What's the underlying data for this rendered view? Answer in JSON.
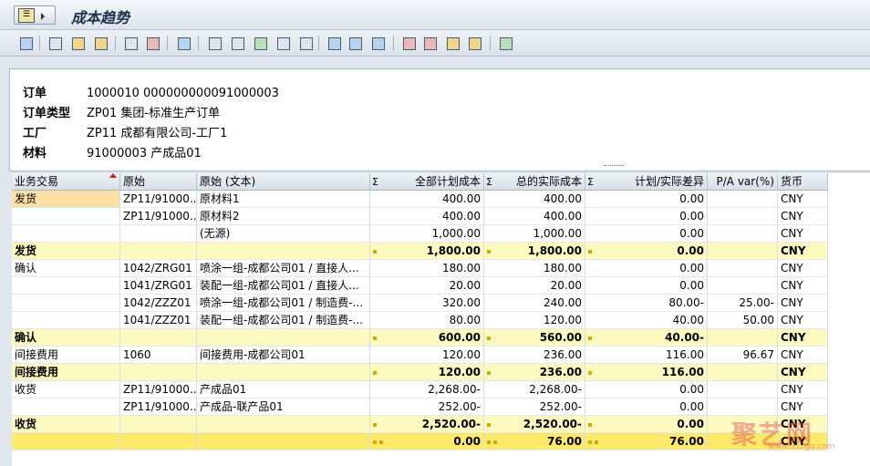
{
  "window": {
    "title": "成本趋势"
  },
  "toolbar": {
    "icons": [
      "detail-icon",
      "print-icon",
      "filter-set-icon",
      "filter-icon",
      "sum-icon",
      "subtotal-icon",
      "print-preview-icon",
      "export-icon",
      "download-icon",
      "spreadsheet-icon",
      "word-processing-icon",
      "abc-analysis-icon",
      "layout-icon",
      "layout-change-icon",
      "layout-save-icon",
      "graphic-icon",
      "distribution-icon",
      "info-icon",
      "settings-icon",
      "chart-icon"
    ]
  },
  "header": {
    "fields": [
      {
        "label": "订单",
        "value": "1000010 000000000091000003"
      },
      {
        "label": "订单类型",
        "value": "ZP01 集团-标准生产订单"
      },
      {
        "label": "工厂",
        "value": "ZP11 成都有限公司-工厂1"
      },
      {
        "label": "材料",
        "value": "91000003 产成品01"
      }
    ]
  },
  "grid": {
    "columns": [
      "业务交易",
      "原始",
      "原始 (文本)",
      "全部计划成本",
      "总的实际成本",
      "计划/实际差异",
      "P/A var(%)",
      "货币"
    ],
    "rows": [
      {
        "type": "data",
        "selected": true,
        "c": [
          "发货",
          "ZP11/91000...",
          "原材料1",
          "400.00",
          "400.00",
          "0.00",
          "",
          "CNY"
        ]
      },
      {
        "type": "data",
        "c": [
          "",
          "ZP11/91000...",
          "原材料2",
          "400.00",
          "400.00",
          "0.00",
          "",
          "CNY"
        ]
      },
      {
        "type": "data",
        "c": [
          "",
          "",
          "(无源)",
          "1,000.00",
          "1,000.00",
          "0.00",
          "",
          "CNY"
        ]
      },
      {
        "type": "sum",
        "c": [
          "发货",
          "",
          "",
          "1,800.00",
          "1,800.00",
          "0.00",
          "",
          "CNY"
        ]
      },
      {
        "type": "data",
        "c": [
          "确认",
          "1042/ZRG01",
          "喷涂一组-成都公司01 / 直接人...",
          "180.00",
          "180.00",
          "0.00",
          "",
          "CNY"
        ]
      },
      {
        "type": "data",
        "c": [
          "",
          "1041/ZRG01",
          "装配一组-成都公司01 / 直接人...",
          "20.00",
          "20.00",
          "0.00",
          "",
          "CNY"
        ]
      },
      {
        "type": "data",
        "c": [
          "",
          "1042/ZZZ01",
          "喷涂一组-成都公司01 / 制造费-...",
          "320.00",
          "240.00",
          "80.00-",
          "25.00-",
          "CNY"
        ]
      },
      {
        "type": "data",
        "c": [
          "",
          "1041/ZZZ01",
          "装配一组-成都公司01 / 制造费-...",
          "80.00",
          "120.00",
          "40.00",
          "50.00",
          "CNY"
        ]
      },
      {
        "type": "sum",
        "c": [
          "确认",
          "",
          "",
          "600.00",
          "560.00",
          "40.00-",
          "",
          "CNY"
        ]
      },
      {
        "type": "data",
        "c": [
          "间接费用",
          "1060",
          "间接费用-成都公司01",
          "120.00",
          "236.00",
          "116.00",
          "96.67",
          "CNY"
        ]
      },
      {
        "type": "sum",
        "c": [
          "间接费用",
          "",
          "",
          "120.00",
          "236.00",
          "116.00",
          "",
          "CNY"
        ]
      },
      {
        "type": "data",
        "c": [
          "收货",
          "ZP11/91000...",
          "产成品01",
          "2,268.00-",
          "2,268.00-",
          "0.00",
          "",
          "CNY"
        ]
      },
      {
        "type": "data",
        "c": [
          "",
          "ZP11/91000...",
          "产成品-联产品01",
          "252.00-",
          "252.00-",
          "0.00",
          "",
          "CNY"
        ]
      },
      {
        "type": "sum",
        "c": [
          "收货",
          "",
          "",
          "2,520.00-",
          "2,520.00-",
          "0.00",
          "",
          "CNY"
        ]
      },
      {
        "type": "grand",
        "c": [
          "",
          "",
          "",
          "0.00",
          "76.00",
          "76.00",
          "",
          "CNY"
        ]
      }
    ]
  },
  "watermark": {
    "text": "聚艺网",
    "sub": "www.51cgo.com"
  },
  "colors": {
    "sum_row": "#fdfabf",
    "grand_row": "#ffe96a",
    "selected_cell": "#fde0a6",
    "header_bg": "#dfe6ee"
  }
}
